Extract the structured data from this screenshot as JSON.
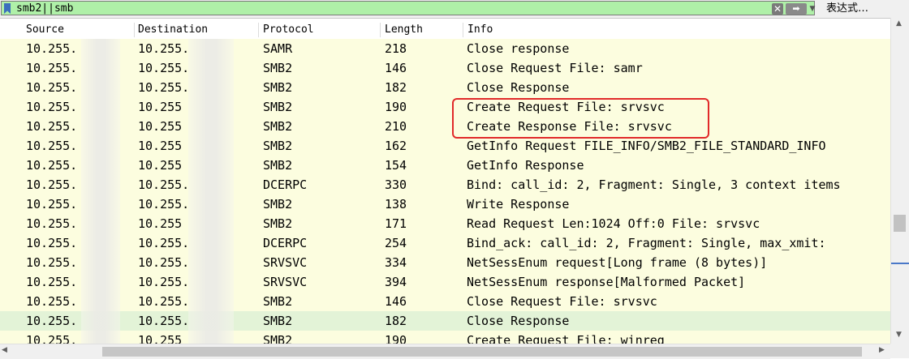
{
  "filter": {
    "value": "smb2||smb",
    "expression_label": "表达式…",
    "clear_glyph": "✕",
    "apply_glyph": "➡",
    "dropdown_glyph": "▼"
  },
  "columns": [
    "Source",
    "Destination",
    "Protocol",
    "Length",
    "Info"
  ],
  "packets": [
    {
      "source": "10.255.",
      "destination": "10.255.",
      "protocol": "SAMR",
      "length": "218",
      "info": "Close response"
    },
    {
      "source": "10.255.",
      "destination": "10.255.",
      "protocol": "SMB2",
      "length": "146",
      "info": "Close Request File: samr"
    },
    {
      "source": "10.255.",
      "destination": "10.255.",
      "protocol": "SMB2",
      "length": "182",
      "info": "Close Response"
    },
    {
      "source": "10.255.",
      "destination": "10.255",
      "protocol": "SMB2",
      "length": "190",
      "info": "Create Request File: srvsvc"
    },
    {
      "source": "10.255.",
      "destination": "10.255",
      "protocol": "SMB2",
      "length": "210",
      "info": "Create Response File: srvsvc"
    },
    {
      "source": "10.255.",
      "destination": "10.255",
      "protocol": "SMB2",
      "length": "162",
      "info": "GetInfo Request FILE_INFO/SMB2_FILE_STANDARD_INFO"
    },
    {
      "source": "10.255.",
      "destination": "10.255",
      "protocol": "SMB2",
      "length": "154",
      "info": "GetInfo Response"
    },
    {
      "source": "10.255.",
      "destination": "10.255.",
      "protocol": "DCERPC",
      "length": "330",
      "info": "Bind: call_id: 2, Fragment: Single, 3 context items"
    },
    {
      "source": "10.255.",
      "destination": "10.255.",
      "protocol": "SMB2",
      "length": "138",
      "info": "Write Response"
    },
    {
      "source": "10.255.",
      "destination": "10.255",
      "protocol": "SMB2",
      "length": "171",
      "info": "Read Request Len:1024 Off:0 File: srvsvc"
    },
    {
      "source": "10.255.",
      "destination": "10.255.",
      "protocol": "DCERPC",
      "length": "254",
      "info": "Bind_ack: call_id: 2, Fragment: Single, max_xmit:"
    },
    {
      "source": "10.255.",
      "destination": "10.255.",
      "protocol": "SRVSVC",
      "length": "334",
      "info": "NetSessEnum request[Long frame (8 bytes)]"
    },
    {
      "source": "10.255.",
      "destination": "10.255.",
      "protocol": "SRVSVC",
      "length": "394",
      "info": "NetSessEnum response[Malformed Packet]"
    },
    {
      "source": "10.255.",
      "destination": "10.255.",
      "protocol": "SMB2",
      "length": "146",
      "info": "Close Request File: srvsvc"
    },
    {
      "source": "10.255.",
      "destination": "10.255.",
      "protocol": "SMB2",
      "length": "182",
      "info": "Close Response"
    },
    {
      "source": "10.255.",
      "destination": "10.255",
      "protocol": "SMB2",
      "length": "190",
      "info": "Create Request File: winreg"
    }
  ],
  "selected_index": 14,
  "colors": {
    "row_background": "#fcfddf",
    "selected_row": "#e3f3d7",
    "filter_valid": "#aff0a8",
    "annotation": "#e12a2a"
  }
}
